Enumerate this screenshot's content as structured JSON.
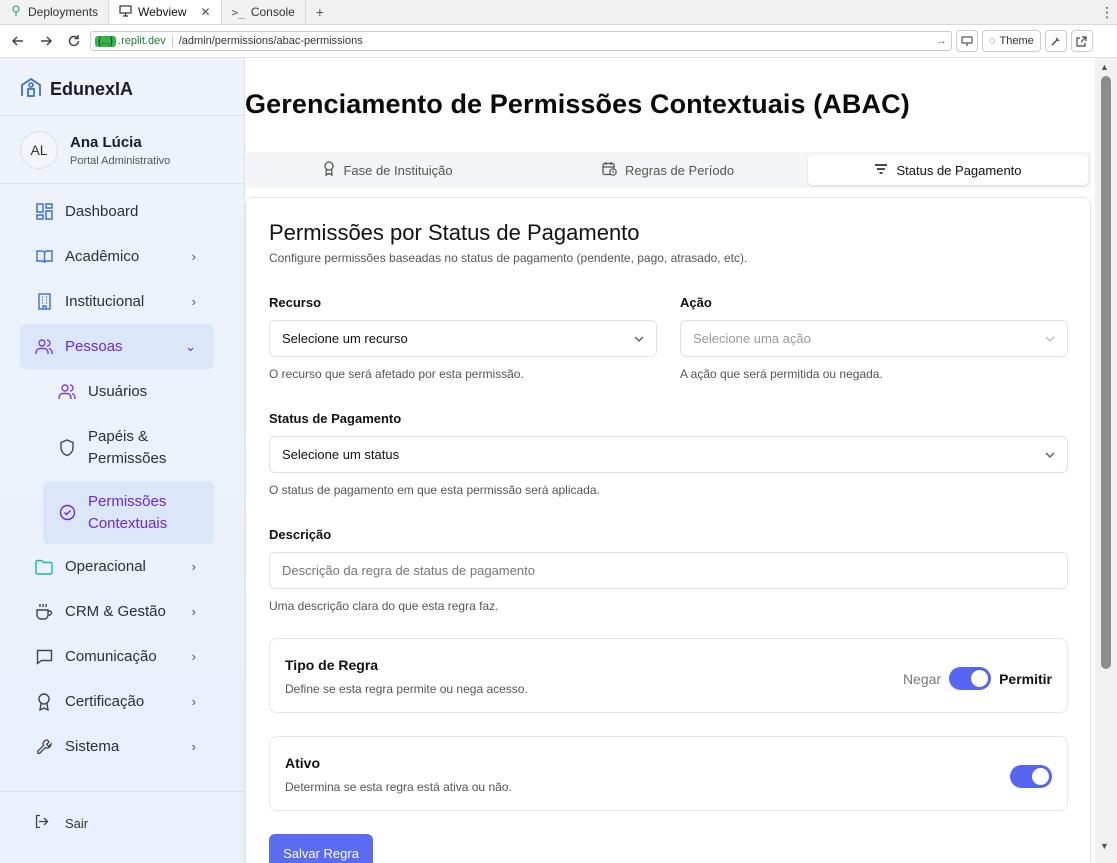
{
  "browser": {
    "tabs": [
      {
        "label": "Deployments",
        "icon": "deploy-icon"
      },
      {
        "label": "Webview",
        "icon": "monitor-icon"
      },
      {
        "label": "Console",
        "icon": "terminal-icon"
      }
    ],
    "host_badge": "{...}",
    "host": ".replit.dev",
    "path": "/admin/permissions/abac-permissions",
    "theme_label": "Theme"
  },
  "sidebar": {
    "brand": "EdunexIA",
    "user": {
      "initials": "AL",
      "name": "Ana Lúcia",
      "role": "Portal Administrativo"
    },
    "items": [
      {
        "label": "Dashboard",
        "icon": "dashboard-icon"
      },
      {
        "label": "Acadêmico",
        "icon": "book-icon"
      },
      {
        "label": "Institucional",
        "icon": "building-icon"
      },
      {
        "label": "Pessoas",
        "icon": "users-icon"
      },
      {
        "label": "Operacional",
        "icon": "folder-icon"
      },
      {
        "label": "CRM & Gestão",
        "icon": "coffee-icon"
      },
      {
        "label": "Comunicação",
        "icon": "message-icon"
      },
      {
        "label": "Certificação",
        "icon": "award-icon"
      },
      {
        "label": "Sistema",
        "icon": "wrench-icon"
      }
    ],
    "sub_items": [
      {
        "label": "Usuários",
        "icon": "user-group-icon"
      },
      {
        "label": "Papéis & Permissões",
        "line1": "Papéis &",
        "line2": "Permissões",
        "icon": "shield-icon"
      },
      {
        "label": "Permissões Contextuais",
        "line1": "Permissões",
        "line2": "Contextuais",
        "icon": "check-circle-icon"
      }
    ],
    "logout": "Sair"
  },
  "main": {
    "title": "Gerenciamento de Permissões Contextuais (ABAC)",
    "tabs": [
      {
        "label": "Fase de Instituição"
      },
      {
        "label": "Regras de Período"
      },
      {
        "label": "Status de Pagamento"
      }
    ],
    "card": {
      "title": "Permissões por Status de Pagamento",
      "subtitle": "Configure permissões baseadas no status de pagamento (pendente, pago, atrasado, etc).",
      "recurso": {
        "label": "Recurso",
        "value": "Selecione um recurso",
        "help": "O recurso que será afetado por esta permissão."
      },
      "acao": {
        "label": "Ação",
        "value": "Selecione uma ação",
        "help": "A ação que será permitida ou negada."
      },
      "status": {
        "label": "Status de Pagamento",
        "value": "Selecione um status",
        "help": "O status de pagamento em que esta permissão será aplicada."
      },
      "descricao": {
        "label": "Descrição",
        "placeholder": "Descrição da regra de status de pagamento",
        "help": "Uma descrição clara do que esta regra faz."
      },
      "tipo": {
        "title": "Tipo de Regra",
        "desc": "Define se esta regra permite ou nega acesso.",
        "off_label": "Negar",
        "on_label": "Permitir",
        "enabled": true
      },
      "ativo": {
        "title": "Ativo",
        "desc": "Determina se esta regra está ativa ou não.",
        "enabled": true
      },
      "save_label": "Salvar Regra"
    }
  },
  "colors": {
    "accent": "#5865f2",
    "active_nav": "#6d28d9",
    "sidebar_bg": "#eef3fb"
  }
}
